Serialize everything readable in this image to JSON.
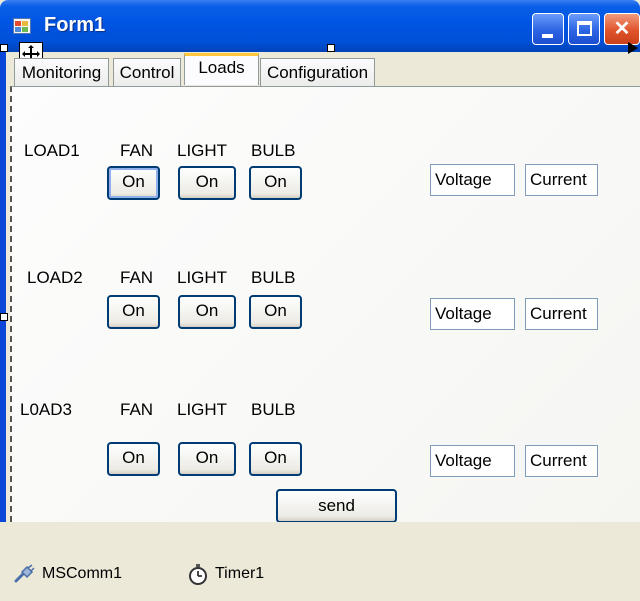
{
  "window": {
    "title": "Form1"
  },
  "tabs": [
    "Monitoring",
    "Control",
    "Loads",
    "Configuration"
  ],
  "active_tab": "Loads",
  "column_headers": [
    "FAN",
    "LIGHT",
    "BULB"
  ],
  "loads": [
    {
      "name": "LOAD1",
      "buttons": [
        "On",
        "On",
        "On"
      ],
      "voltage": "Voltage",
      "current": "Current"
    },
    {
      "name": "LOAD2",
      "buttons": [
        "On",
        "On",
        "On"
      ],
      "voltage": "Voltage",
      "current": "Current"
    },
    {
      "name": "L0AD3",
      "buttons": [
        "On",
        "On",
        "On"
      ],
      "voltage": "Voltage",
      "current": "Current"
    }
  ],
  "send_label": "send",
  "tray": [
    {
      "label": "MSComm1",
      "icon": "serial-port-icon"
    },
    {
      "label": "Timer1",
      "icon": "stopwatch-icon"
    }
  ],
  "colors": {
    "titlebar": "#0054e3",
    "active_tab_accent": "#ffc83c",
    "button_border": "#003c74"
  }
}
